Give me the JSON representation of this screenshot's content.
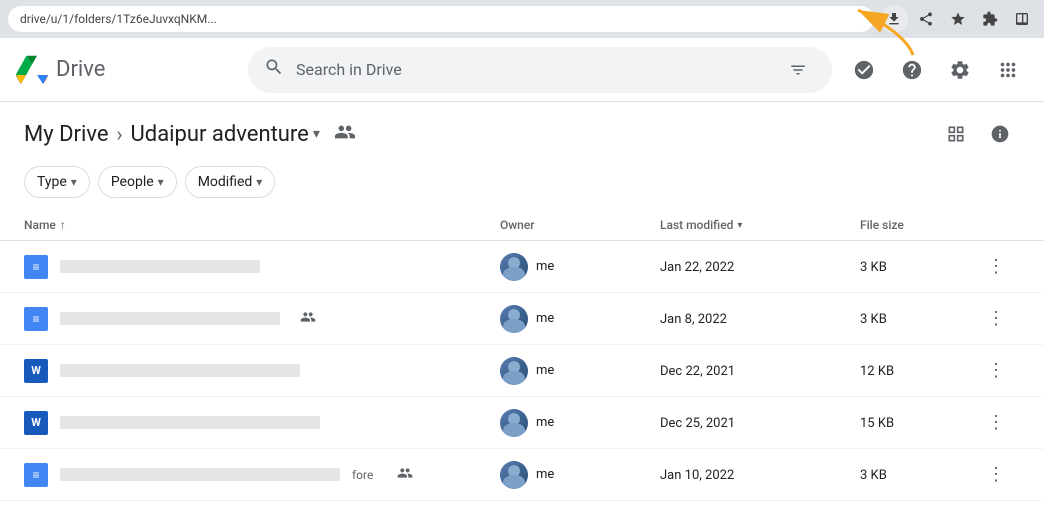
{
  "browser": {
    "address": "drive/u/1/folders/1Tz6eJuvxqNKM...",
    "icons": [
      "download",
      "share",
      "star",
      "extension",
      "sidebar"
    ]
  },
  "header": {
    "search_placeholder": "Search in Drive",
    "icons": [
      "task-done",
      "help",
      "settings",
      "apps-grid"
    ]
  },
  "breadcrumb": {
    "my_drive": "My Drive",
    "separator": ">",
    "current_folder": "Udaipur adventure",
    "dropdown_arrow": "▾"
  },
  "filters": [
    {
      "label": "Type",
      "arrow": "▾"
    },
    {
      "label": "People",
      "arrow": "▾"
    },
    {
      "label": "Modified",
      "arrow": "▾"
    }
  ],
  "columns": {
    "name": "Name",
    "sort_icon": "↑",
    "owner": "Owner",
    "last_modified": "Last modified",
    "sort_down": "▾",
    "file_size": "File size"
  },
  "files": [
    {
      "icon_type": "doc",
      "icon_letter": "≡",
      "name": "blurred-text-1",
      "name_display": "████████████████████████████████",
      "has_shared": false,
      "owner": "me",
      "modified": "Jan 22, 2022",
      "size": "3 KB"
    },
    {
      "icon_type": "doc",
      "icon_letter": "≡",
      "name": "blurred-text-2",
      "name_display": "████████████████████████████████████",
      "has_shared": true,
      "shared_label": "",
      "owner": "me",
      "modified": "Jan 8, 2022",
      "size": "3 KB"
    },
    {
      "icon_type": "word",
      "icon_letter": "W",
      "name": "blurred-text-3",
      "name_display": "████████████████",
      "has_shared": false,
      "owner": "me",
      "modified": "Dec 22, 2021",
      "size": "12 KB"
    },
    {
      "icon_type": "word",
      "icon_letter": "W",
      "name": "blurred-text-4",
      "name_display": "██████████████████████████",
      "has_shared": false,
      "owner": "me",
      "modified": "Dec 25, 2021",
      "size": "15 KB"
    },
    {
      "icon_type": "doc",
      "icon_letter": "≡",
      "name": "blurred-text-5",
      "name_display": "████████████████████████████████",
      "has_shared": true,
      "shared_label": "fore",
      "owner": "me",
      "modified": "Jan 10, 2022",
      "size": "3 KB"
    }
  ]
}
